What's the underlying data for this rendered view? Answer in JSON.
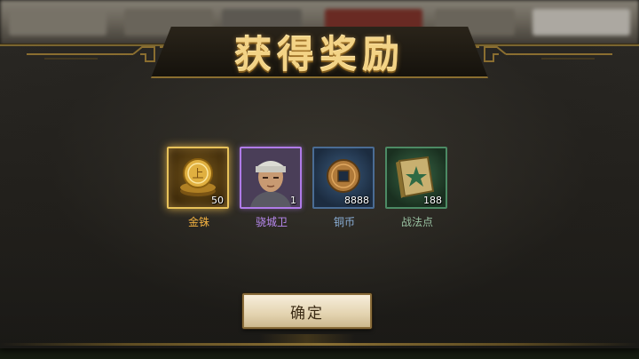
{
  "dialog": {
    "title": "获得奖励",
    "confirm_label": "确定"
  },
  "rewards": [
    {
      "name": "金铢",
      "quantity": "50",
      "icon": "gold-coin-icon",
      "rarity_color": "#e8c25a"
    },
    {
      "name": "骁城卫",
      "quantity": "1",
      "icon": "soldier-portrait-icon",
      "rarity_color": "#b07be8"
    },
    {
      "name": "铜币",
      "quantity": "8888",
      "icon": "copper-coin-icon",
      "rarity_color": "#4a6c94"
    },
    {
      "name": "战法点",
      "quantity": "188",
      "icon": "tactic-book-icon",
      "rarity_color": "#4c8a64"
    }
  ]
}
